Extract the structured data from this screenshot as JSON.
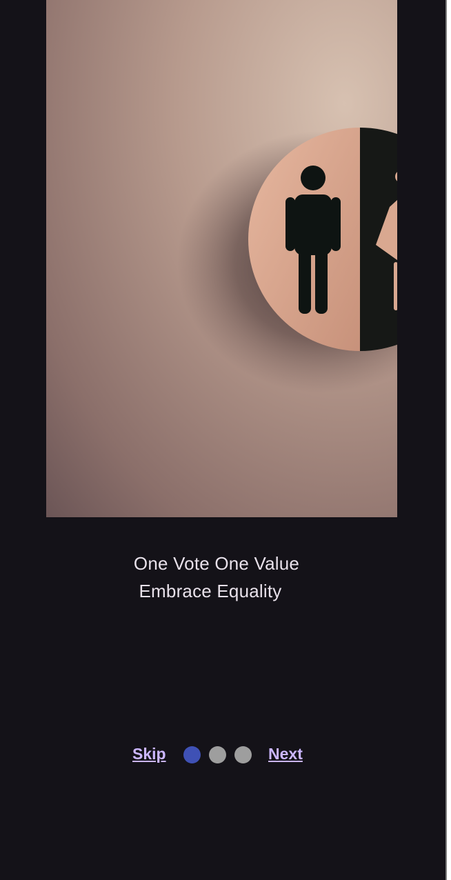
{
  "onboarding": {
    "line1": "One Vote One Value",
    "line2": "Embrace Equality"
  },
  "controls": {
    "skip_label": "Skip",
    "next_label": "Next",
    "page_count": 3,
    "active_page": 1
  },
  "colors": {
    "background": "#141218",
    "link": "#cbb6ff",
    "dot_active": "#3f51b5",
    "dot_inactive": "#9e9e9e"
  }
}
